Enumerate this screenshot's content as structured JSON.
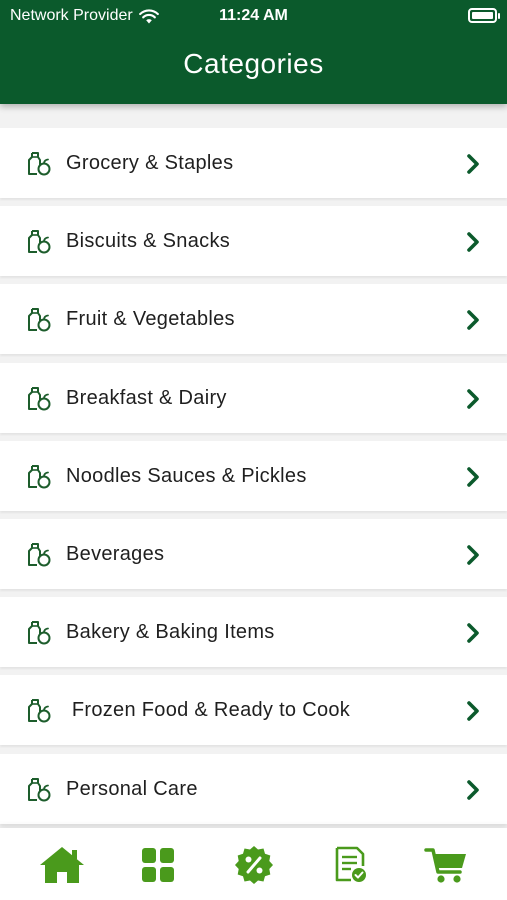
{
  "status_bar": {
    "carrier": "Network Provider",
    "time": "11:24 AM"
  },
  "header": {
    "title": "Categories"
  },
  "colors": {
    "header_bg": "#0b5a2c",
    "icon_green": "#4a9a1c",
    "chevron": "#0b5a2c"
  },
  "categories": [
    {
      "label": "Grocery & Staples",
      "icon": "grocery-bag-icon"
    },
    {
      "label": "Biscuits & Snacks",
      "icon": "grocery-bag-icon"
    },
    {
      "label": "Fruit & Vegetables",
      "icon": "grocery-bag-icon"
    },
    {
      "label": "Breakfast & Dairy",
      "icon": "grocery-bag-icon"
    },
    {
      "label": "Noodles Sauces & Pickles",
      "icon": "grocery-bag-icon"
    },
    {
      "label": "Beverages",
      "icon": "grocery-bag-icon"
    },
    {
      "label": "Bakery & Baking Items",
      "icon": "grocery-bag-icon"
    },
    {
      "label": " Frozen Food & Ready to Cook",
      "icon": "grocery-bag-icon"
    },
    {
      "label": "Personal Care",
      "icon": "grocery-bag-icon"
    }
  ],
  "tabbar": {
    "items": [
      {
        "icon": "home-icon"
      },
      {
        "icon": "grid-icon"
      },
      {
        "icon": "discount-badge-icon"
      },
      {
        "icon": "orders-document-icon"
      },
      {
        "icon": "cart-icon"
      }
    ]
  }
}
